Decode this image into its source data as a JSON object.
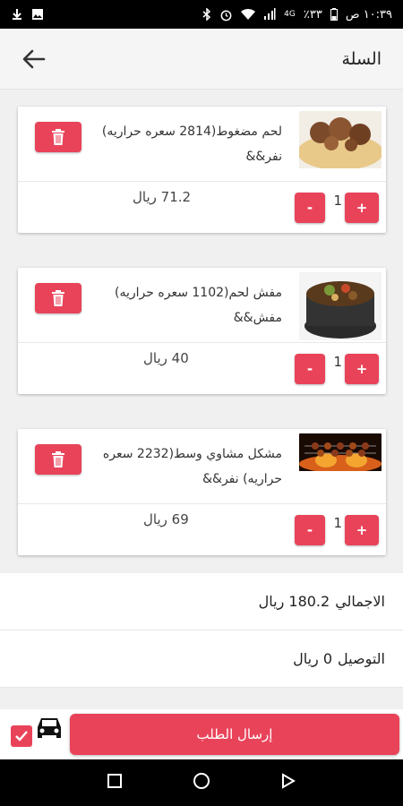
{
  "status_bar": {
    "time": "١٠:٣٩ ص",
    "battery": "٪٣٣",
    "network": "4G"
  },
  "header": {
    "title": "السلة"
  },
  "cart_items": [
    {
      "name": "لحم مضغوط(2814 سعره حراريه) نفر&&",
      "price": "71.2 ريال",
      "quantity": "1",
      "plus_label": "+",
      "minus_label": "-"
    },
    {
      "name": "مفش لحم(1102 سعره حراريه) مفش&&",
      "price": "40 ريال",
      "quantity": "1",
      "plus_label": "+",
      "minus_label": "-"
    },
    {
      "name": "مشكل مشاوي وسط(2232 سعره حراريه) نفر&&",
      "price": "69 ريال",
      "quantity": "1",
      "plus_label": "+",
      "minus_label": "-"
    }
  ],
  "summary": {
    "total_label": "الاجمالي",
    "total_value": "180.2 ريال",
    "delivery_label": "التوصيل",
    "delivery_value": "0 ريال"
  },
  "footer": {
    "submit_label": "إرسال الطلب",
    "checkbox_checked": true
  },
  "colors": {
    "accent": "#e9435a",
    "background": "#f0f0f0"
  },
  "icons": {
    "back": "arrow-left-icon",
    "delete": "trash-icon",
    "delivery": "car-icon",
    "checkbox": "checkmark-icon"
  }
}
